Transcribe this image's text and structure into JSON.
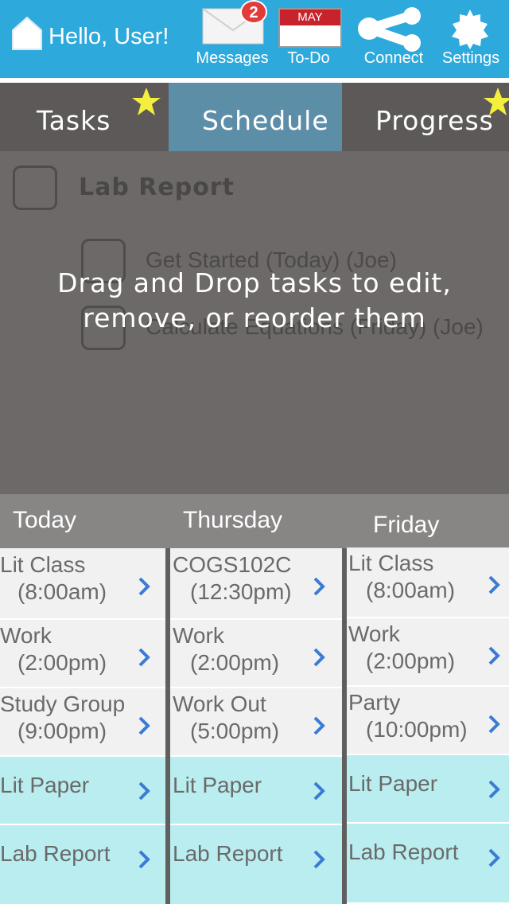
{
  "header": {
    "greeting": "Hello, User!",
    "messages_label": "Messages",
    "messages_badge": "2",
    "todo_label": "To-Do",
    "todo_month": "MAY",
    "connect_label": "Connect",
    "settings_label": "Settings",
    "icons": [
      "home-icon",
      "envelope-icon",
      "calendar-icon",
      "share-icon",
      "gear-icon"
    ]
  },
  "tabs": [
    {
      "label": "Tasks",
      "starred": true,
      "active": false
    },
    {
      "label": "Schedule",
      "starred": false,
      "active": true
    },
    {
      "label": "Progress",
      "starred": true,
      "active": false
    }
  ],
  "task": {
    "title": "Lab Report",
    "subtasks": [
      "Get Started (Today) (Joe)",
      "Calculate Equations (Friday) (Joe)"
    ]
  },
  "overlay": {
    "line1": "Drag and Drop tasks to edit,",
    "line2": "remove, or reorder them"
  },
  "days": [
    {
      "name": "Today",
      "items": [
        {
          "title": "Lit Class",
          "time": "(8:00am)"
        },
        {
          "title": "Work",
          "time": "(2:00pm)"
        },
        {
          "title": "Study Group",
          "time": "(9:00pm)"
        },
        {
          "title": "Lit Paper"
        },
        {
          "title": "Lab Report"
        }
      ]
    },
    {
      "name": "Thursday",
      "items": [
        {
          "title": "COGS102C",
          "time": "(12:30pm)"
        },
        {
          "title": "Work",
          "time": "(2:00pm)"
        },
        {
          "title": "Work Out",
          "time": "(5:00pm)"
        },
        {
          "title": "Lit Paper"
        },
        {
          "title": "Lab Report"
        }
      ]
    },
    {
      "name": "Friday",
      "items": [
        {
          "title": "Lit Class",
          "time": "(8:00am)"
        },
        {
          "title": "Work",
          "time": "(2:00pm)"
        },
        {
          "title": "Party",
          "time": "(10:00pm)"
        },
        {
          "title": "Lit Paper"
        },
        {
          "title": "Lab Report"
        }
      ]
    }
  ],
  "colors": {
    "header_bg": "#2ea9dc",
    "active_tab": "#5d8ea8",
    "todo_bg": "#b9edef",
    "event_bg": "#f1f1f1",
    "badge": "#e33a3a",
    "chevron": "#3a7bd5"
  }
}
